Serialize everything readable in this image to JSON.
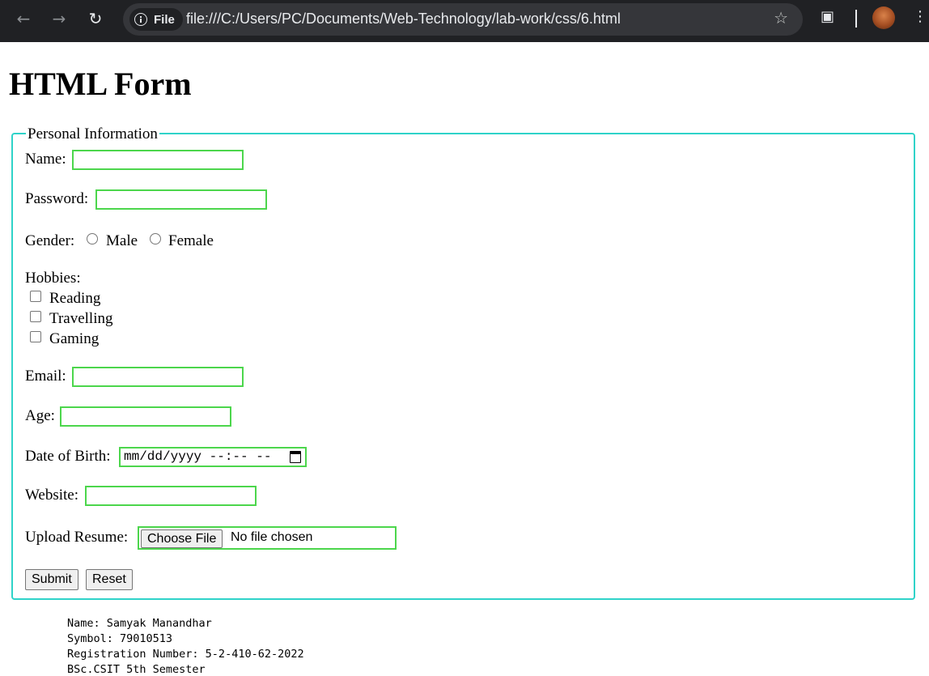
{
  "browser": {
    "url": "file:///C:/Users/PC/Documents/Web-Technology/lab-work/css/6.html",
    "security_chip": "File"
  },
  "page": {
    "heading": "HTML Form",
    "fieldset_legend": "Personal Information",
    "form": {
      "name_label": "Name:",
      "password_label": "Password:",
      "gender_label": "Gender:",
      "gender_options": [
        "Male",
        "Female"
      ],
      "hobbies_label": "Hobbies:",
      "hobbies": [
        "Reading",
        "Travelling",
        "Gaming"
      ],
      "email_label": "Email:",
      "age_label": "Age:",
      "dob_label": "Date of Birth:",
      "dob_placeholder": "mm/dd/yyyy --:-- --",
      "website_label": "Website:",
      "resume_label": "Upload Resume:",
      "choose_file_label": "Choose File",
      "file_status": "No file chosen",
      "submit_label": "Submit",
      "reset_label": "Reset"
    },
    "footer_info": [
      "Name: Samyak Manandhar",
      "Symbol: 79010513",
      "Registration Number: 5-2-410-62-2022",
      "BSc.CSIT 5th Semester"
    ]
  }
}
